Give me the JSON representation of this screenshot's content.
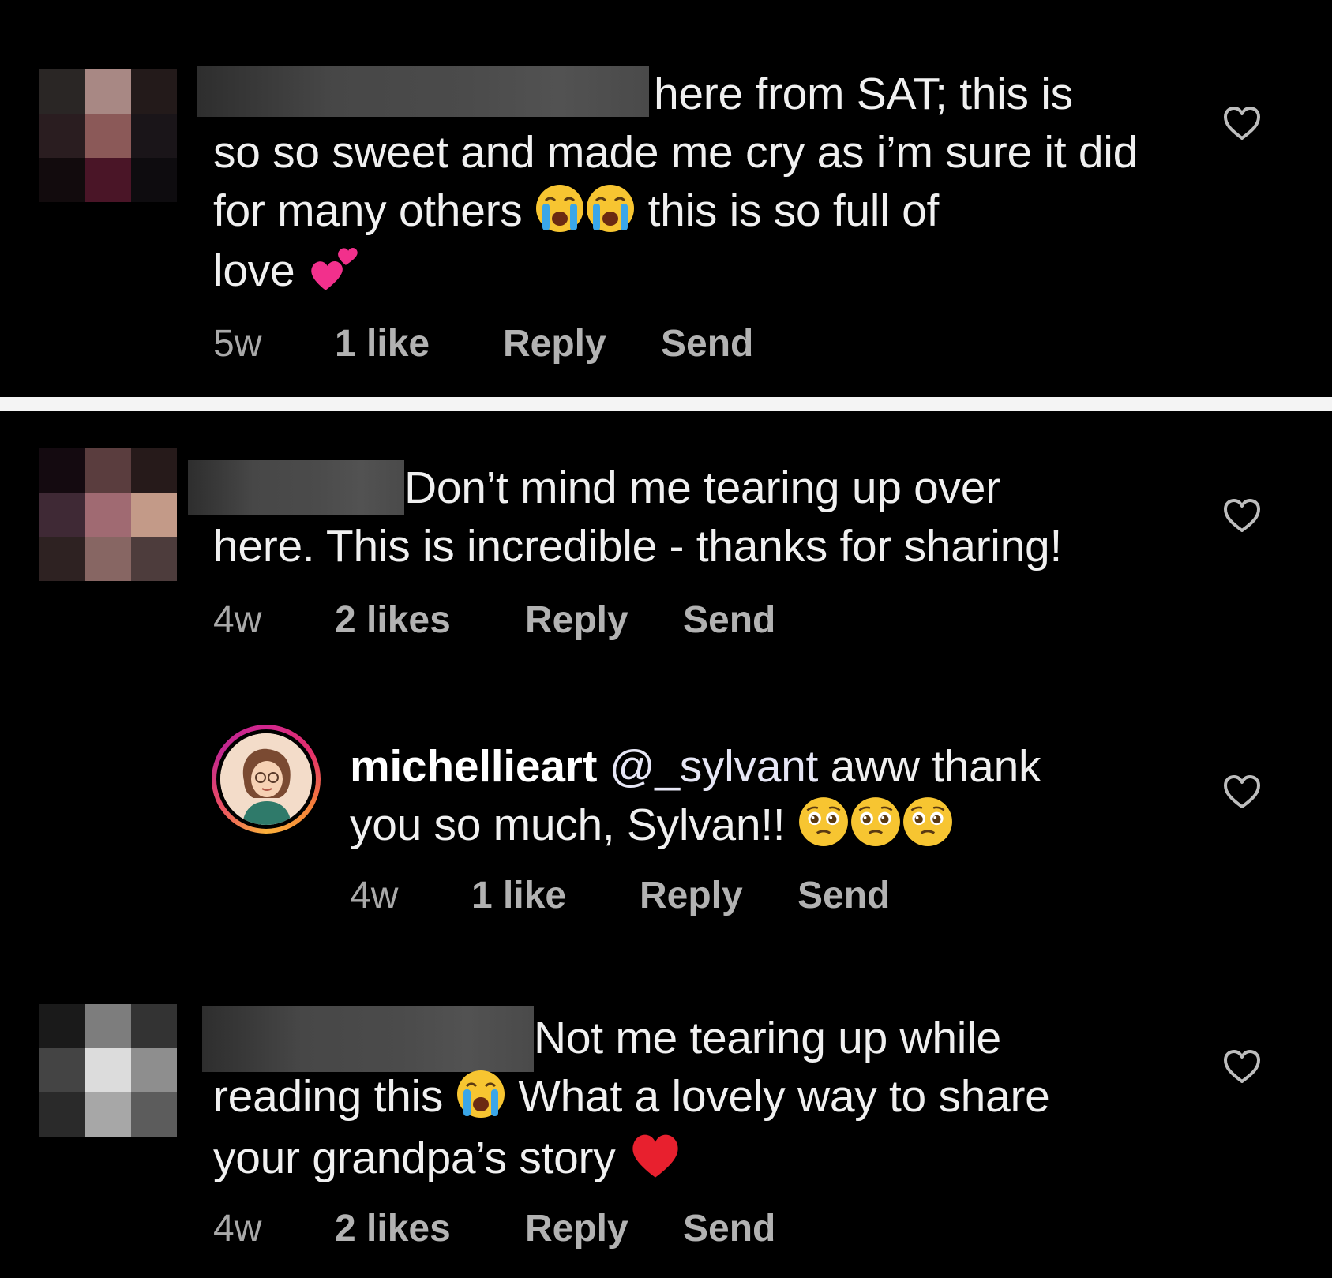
{
  "comments": [
    {
      "text_line1": "here from SAT; this is",
      "text_rest": "so so sweet and made me cry as i’m sure it did for many others",
      "text_after_emoji": "this is so full of",
      "text_end": "love",
      "emojis": [
        "crying-face",
        "crying-face",
        "two-hearts"
      ],
      "time": "5w",
      "likes": "1 like",
      "reply_label": "Reply",
      "send_label": "Send"
    },
    {
      "text_line1": "Don’t mind me tearing up over",
      "text_rest": "here. This is incredible - thanks for sharing!",
      "time": "4w",
      "likes": "2 likes",
      "reply_label": "Reply",
      "send_label": "Send"
    },
    {
      "username": "michellieart",
      "mention": "@_sylvant",
      "text_line1": "aww thank",
      "text_rest": "you so much, Sylvan!!",
      "emojis": [
        "pleading-face",
        "pleading-face",
        "pleading-face"
      ],
      "time": "4w",
      "likes": "1 like",
      "reply_label": "Reply",
      "send_label": "Send"
    },
    {
      "text_line1": "Not me tearing up while",
      "text_line2a": "reading this",
      "text_line2b": "What a lovely way to share",
      "text_line3": "your grandpa’s story",
      "emojis": [
        "crying-face",
        "red-heart"
      ],
      "time": "4w",
      "likes": "2 likes",
      "reply_label": "Reply",
      "send_label": "Send"
    }
  ],
  "colors": {
    "background": "#000000",
    "text": "#f0f0f0",
    "meta": "#a9a9a9",
    "divider": "#f4f4f4"
  },
  "icons": [
    "heart-outline-icon",
    "crying-face-emoji",
    "two-hearts-emoji",
    "pleading-face-emoji",
    "red-heart-emoji"
  ]
}
